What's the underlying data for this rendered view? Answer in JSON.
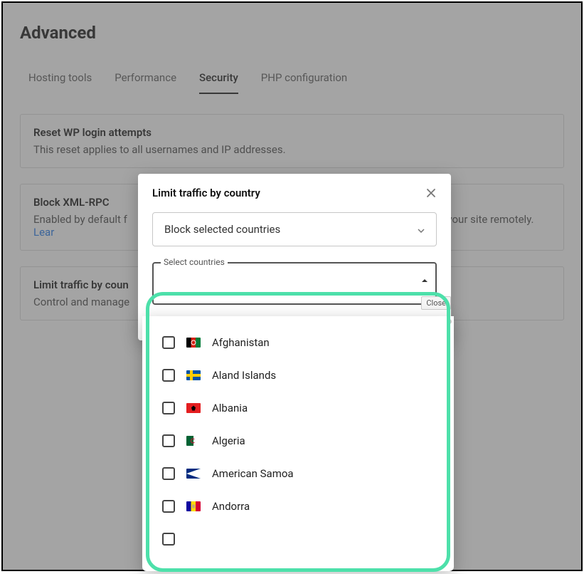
{
  "page": {
    "title": "Advanced"
  },
  "tabs": {
    "hosting": "Hosting tools",
    "performance": "Performance",
    "security": "Security",
    "php": "PHP configuration"
  },
  "cards": {
    "reset": {
      "title": "Reset WP login attempts",
      "desc": "This reset applies to all usernames and IP addresses."
    },
    "xmlrpc": {
      "title": "Block XML-RPC",
      "desc_left": "Enabled by default f",
      "desc_right": "g your site remotely. ",
      "learn": "Lear"
    },
    "limit": {
      "title": "Limit traffic by coun",
      "desc": "Control and manage"
    }
  },
  "modal": {
    "title": "Limit traffic by country",
    "select_value": "Block selected countries",
    "fieldset_legend": "Select countries",
    "tooltip": "Close"
  },
  "countries": {
    "af": "Afghanistan",
    "ax": "Aland Islands",
    "al": "Albania",
    "dz": "Algeria",
    "as": "American Samoa",
    "ad": "Andorra"
  }
}
